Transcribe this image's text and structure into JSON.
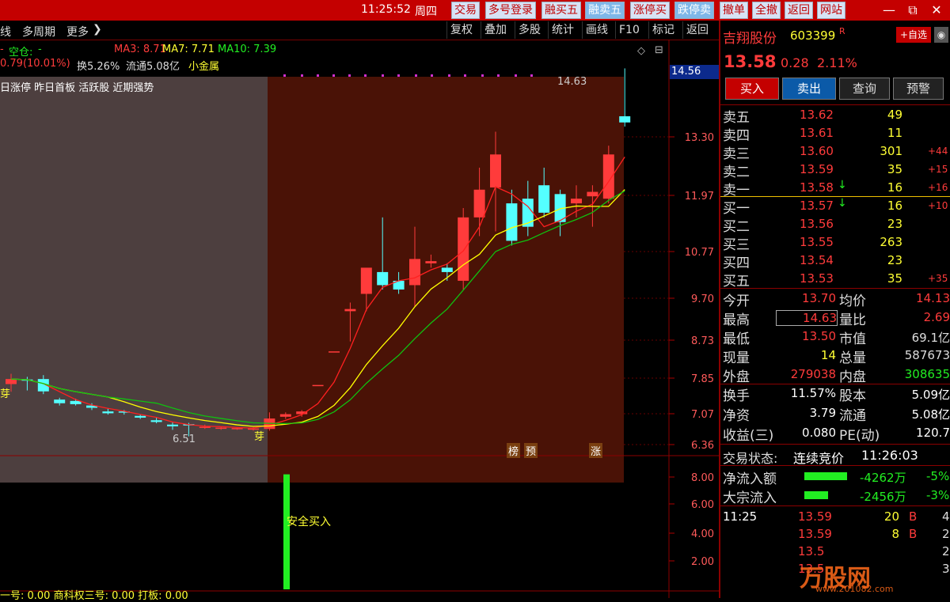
{
  "titlebar": {
    "time": "11:25:52",
    "weekday": "周四",
    "buttons": [
      "交易",
      "多号登录",
      "融买五",
      "融卖五",
      "涨停买",
      "跌停卖",
      "撤单",
      "全撤",
      "返回",
      "网站"
    ],
    "win_controls": [
      "—",
      "⧉",
      "✕"
    ]
  },
  "toolbar": {
    "left_items": [
      "线",
      "多周期",
      "更多"
    ],
    "right_items": [
      "复权",
      "叠加",
      "多股",
      "统计",
      "画线",
      "F10",
      "标记",
      "返回"
    ]
  },
  "chart_header": {
    "position_label": "空仓:",
    "position_value": "-",
    "ma3": "MA3: 8.71",
    "ma7": "MA7: 7.71",
    "ma10": "MA10: 7.39",
    "change": "0.79(10.01%)",
    "turnover": "换5.26%",
    "float": "流通5.08亿",
    "sector": "小金属",
    "tags": "日涨停 昨日首板 活跃股 近期强势",
    "price_marker": "14.56",
    "high_label": "14.63",
    "low_label": "6.51",
    "bottom_tags": [
      "榜",
      "预",
      "涨"
    ],
    "bud_label": "芽"
  },
  "indicator": {
    "label": "安全买入",
    "bottom_text": "一号: 0.00   商科权三号: 0.00   打板: 0.00"
  },
  "chart_data": {
    "type": "candlestick",
    "y_ticks": [
      13.3,
      11.97,
      10.77,
      9.7,
      8.73,
      7.85,
      7.07,
      6.36
    ],
    "indicator_ticks": [
      8.0,
      6.0,
      4.0,
      2.0
    ],
    "candles": [
      {
        "o": 7.72,
        "h": 7.95,
        "l": 7.55,
        "c": 7.83
      },
      {
        "o": 7.82,
        "h": 7.88,
        "l": 7.58,
        "c": 7.8
      },
      {
        "o": 7.83,
        "h": 7.92,
        "l": 7.5,
        "c": 7.56
      },
      {
        "o": 7.38,
        "h": 7.42,
        "l": 7.25,
        "c": 7.3
      },
      {
        "o": 7.35,
        "h": 7.4,
        "l": 7.25,
        "c": 7.28
      },
      {
        "o": 7.25,
        "h": 7.3,
        "l": 7.15,
        "c": 7.2
      },
      {
        "o": 7.12,
        "h": 7.18,
        "l": 7.05,
        "c": 7.08
      },
      {
        "o": 7.12,
        "h": 7.15,
        "l": 7.05,
        "c": 7.1
      },
      {
        "o": 7.02,
        "h": 7.05,
        "l": 6.95,
        "c": 6.98
      },
      {
        "o": 6.92,
        "h": 6.98,
        "l": 6.85,
        "c": 6.88
      },
      {
        "o": 6.82,
        "h": 6.88,
        "l": 6.7,
        "c": 6.78
      },
      {
        "o": 6.83,
        "h": 6.86,
        "l": 6.55,
        "c": 6.8
      },
      {
        "o": 6.76,
        "h": 6.82,
        "l": 6.72,
        "c": 6.77
      },
      {
        "o": 6.74,
        "h": 6.78,
        "l": 6.7,
        "c": 6.75
      },
      {
        "o": 6.73,
        "h": 6.76,
        "l": 6.7,
        "c": 6.74
      },
      {
        "o": 6.72,
        "h": 6.76,
        "l": 6.68,
        "c": 6.73
      },
      {
        "o": 6.72,
        "h": 7.1,
        "l": 6.68,
        "c": 6.96
      },
      {
        "o": 7.0,
        "h": 7.1,
        "l": 6.95,
        "c": 7.06
      },
      {
        "o": 7.06,
        "h": 7.15,
        "l": 7.0,
        "c": 7.12
      },
      {
        "o": 7.7,
        "h": 7.7,
        "l": 7.7,
        "c": 7.7
      },
      {
        "o": 8.47,
        "h": 8.47,
        "l": 8.47,
        "c": 8.47
      },
      {
        "o": 9.4,
        "h": 9.6,
        "l": 8.7,
        "c": 9.45
      },
      {
        "o": 9.8,
        "h": 10.2,
        "l": 9.4,
        "c": 10.4
      },
      {
        "o": 10.3,
        "h": 11.5,
        "l": 9.9,
        "c": 10.0
      },
      {
        "o": 10.1,
        "h": 10.3,
        "l": 9.8,
        "c": 9.9
      },
      {
        "o": 10.0,
        "h": 11.3,
        "l": 9.5,
        "c": 10.6
      },
      {
        "o": 10.5,
        "h": 10.7,
        "l": 10.4,
        "c": 10.55
      },
      {
        "o": 10.4,
        "h": 10.5,
        "l": 10.1,
        "c": 10.3
      },
      {
        "o": 10.1,
        "h": 11.7,
        "l": 9.9,
        "c": 11.5
      },
      {
        "o": 11.5,
        "h": 12.6,
        "l": 11.1,
        "c": 12.1
      },
      {
        "o": 12.15,
        "h": 13.4,
        "l": 11.2,
        "c": 12.9
      },
      {
        "o": 11.8,
        "h": 12.1,
        "l": 10.9,
        "c": 11.0
      },
      {
        "o": 11.9,
        "h": 12.3,
        "l": 11.1,
        "c": 11.3
      },
      {
        "o": 12.2,
        "h": 12.6,
        "l": 11.5,
        "c": 11.6
      },
      {
        "o": 12.0,
        "h": 12.1,
        "l": 11.1,
        "c": 11.4
      },
      {
        "o": 11.8,
        "h": 12.2,
        "l": 11.5,
        "c": 11.9
      },
      {
        "o": 11.95,
        "h": 12.2,
        "l": 11.3,
        "c": 12.05
      },
      {
        "o": 11.9,
        "h": 13.1,
        "l": 11.8,
        "c": 12.9
      },
      {
        "o": 13.7,
        "h": 14.63,
        "l": 13.5,
        "c": 13.58
      }
    ],
    "indicator_bar": {
      "value": 8.2
    }
  },
  "right_panel": {
    "stock_name": "吉翔股份",
    "stock_code": "603399",
    "stock_flag": "R",
    "add_fav": "+自选",
    "price": "13.58",
    "change": "0.28",
    "change_pct": "2.11%",
    "action_buttons": [
      "买入",
      "卖出",
      "查询",
      "预警"
    ],
    "asks": [
      {
        "label": "卖五",
        "price": "13.62",
        "vol": "49",
        "delta": ""
      },
      {
        "label": "卖四",
        "price": "13.61",
        "vol": "11",
        "delta": ""
      },
      {
        "label": "卖三",
        "price": "13.60",
        "vol": "301",
        "delta": "+44"
      },
      {
        "label": "卖二",
        "price": "13.59",
        "vol": "35",
        "delta": "+15"
      },
      {
        "label": "卖一",
        "price": "13.58",
        "vol": "16",
        "delta": "+16"
      }
    ],
    "bids": [
      {
        "label": "买一",
        "price": "13.57",
        "vol": "16",
        "delta": "+10"
      },
      {
        "label": "买二",
        "price": "13.56",
        "vol": "23",
        "delta": ""
      },
      {
        "label": "买三",
        "price": "13.55",
        "vol": "263",
        "delta": ""
      },
      {
        "label": "买四",
        "price": "13.54",
        "vol": "23",
        "delta": ""
      },
      {
        "label": "买五",
        "price": "13.53",
        "vol": "35",
        "delta": "+35"
      }
    ],
    "stats": [
      {
        "l1": "今开",
        "v1": "13.70",
        "l2": "均价",
        "v2": "14.13"
      },
      {
        "l1": "最高",
        "v1": "14.63",
        "l2": "量比",
        "v2": "2.69"
      },
      {
        "l1": "最低",
        "v1": "13.50",
        "l2": "市值",
        "v2": "69.1亿"
      },
      {
        "l1": "现量",
        "v1": "14",
        "l2": "总量",
        "v2": "587673"
      },
      {
        "l1": "外盘",
        "v1": "279038",
        "l2": "内盘",
        "v2": "308635"
      }
    ],
    "stats2": [
      {
        "l1": "换手",
        "v1": "11.57%",
        "l2": "股本",
        "v2": "5.09亿"
      },
      {
        "l1": "净资",
        "v1": "3.79",
        "l2": "流通",
        "v2": "5.08亿"
      },
      {
        "l1": "收益(三)",
        "v1": "0.080",
        "l2": "PE(动)",
        "v2": "120.7"
      }
    ],
    "trade_status_label": "交易状态:",
    "trade_status": "连续竞价",
    "trade_status_time": "11:26:03",
    "flows": [
      {
        "label": "净流入额",
        "value": "-4262万",
        "pct": "-5%"
      },
      {
        "label": "大宗流入",
        "value": "-2456万",
        "pct": "-3%"
      }
    ],
    "ticks": [
      {
        "time": "11:25",
        "price": "13.59",
        "vol": "20",
        "dir": "B",
        "n": "4"
      },
      {
        "time": "",
        "price": "13.59",
        "vol": "8",
        "dir": "B",
        "n": "2"
      },
      {
        "time": "",
        "price": "13.5",
        "vol": "",
        "dir": "",
        "n": "2"
      },
      {
        "time": "",
        "price": "13.5",
        "vol": "",
        "dir": "",
        "n": "3"
      }
    ],
    "watermark": "万股网",
    "watermark_url": "www.201082.com"
  },
  "colors": {
    "up": "#ff3b3b",
    "down": "#54ffff",
    "ma_red": "#ff2020",
    "ma_yellow": "#ffff00",
    "ma_green": "#10c010",
    "bg_left": "#4d3f3f",
    "bg_right": "#4a1206"
  }
}
